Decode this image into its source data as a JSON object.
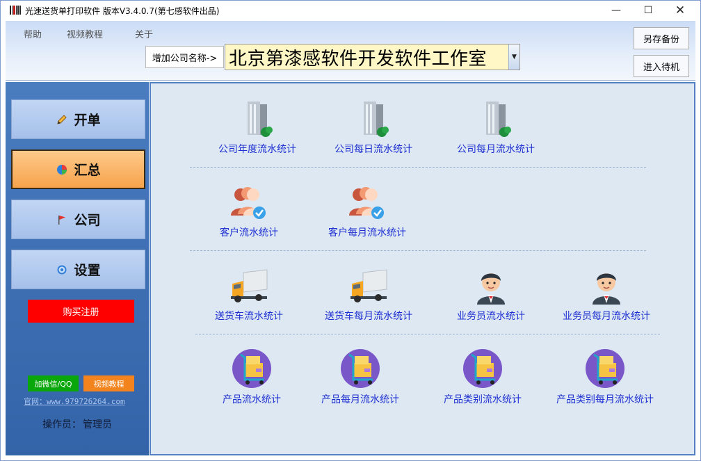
{
  "window": {
    "title": "光速送货单打印软件 版本V3.4.0.7(第七感软件出品)",
    "minimize_glyph": "—",
    "maximize_glyph": "☐",
    "close_glyph": "✕"
  },
  "menu": {
    "items": [
      {
        "label": "帮助"
      },
      {
        "label": "视频教程"
      },
      {
        "label": "关于"
      }
    ]
  },
  "company": {
    "add_label": "增加公司名称->",
    "selected": "北京第漆感软件开发软件工作室",
    "arrow_glyph": "▼"
  },
  "header_buttons": {
    "backup": "另存备份",
    "standby": "进入待机"
  },
  "sidebar": {
    "nav": [
      {
        "label": "开单",
        "icon": "pencil-icon",
        "active": false
      },
      {
        "label": "汇总",
        "icon": "pie-chart-icon",
        "active": true
      },
      {
        "label": "公司",
        "icon": "flag-icon",
        "active": false
      },
      {
        "label": "设置",
        "icon": "gear-icon",
        "active": false
      }
    ],
    "buy_label": "购买注册",
    "wechat_label": "加微信/QQ",
    "video_label": "视频教程",
    "website": "官网：www.979726264.com",
    "operator_label": "操作员：",
    "operator_name": "管理员"
  },
  "tiles": {
    "row1": [
      {
        "label": "公司年度流水统计",
        "icon": "building-icon"
      },
      {
        "label": "公司每日流水统计",
        "icon": "building-icon"
      },
      {
        "label": "公司每月流水统计",
        "icon": "building-icon"
      }
    ],
    "row2": [
      {
        "label": "客户流水统计",
        "icon": "customers-icon"
      },
      {
        "label": "客户每月流水统计",
        "icon": "customers-icon"
      }
    ],
    "row3": [
      {
        "label": "送货车流水统计",
        "icon": "truck-icon"
      },
      {
        "label": "送货车每月流水统计",
        "icon": "truck-icon"
      },
      {
        "label": "业务员流水统计",
        "icon": "salesman-icon"
      },
      {
        "label": "业务员每月流水统计",
        "icon": "salesman-icon"
      }
    ],
    "row4": [
      {
        "label": "产品流水统计",
        "icon": "product-cart-icon"
      },
      {
        "label": "产品每月流水统计",
        "icon": "product-cart-icon"
      },
      {
        "label": "产品类别流水统计",
        "icon": "product-cart-icon"
      },
      {
        "label": "产品类别每月流水统计",
        "icon": "product-cart-icon"
      }
    ]
  },
  "colors": {
    "sidebar": "#3f6fb6",
    "active_nav": "#f6a34c",
    "tile_label": "#1e2fd2",
    "buy_button": "#fe0000",
    "company_field": "#fff8c6"
  }
}
